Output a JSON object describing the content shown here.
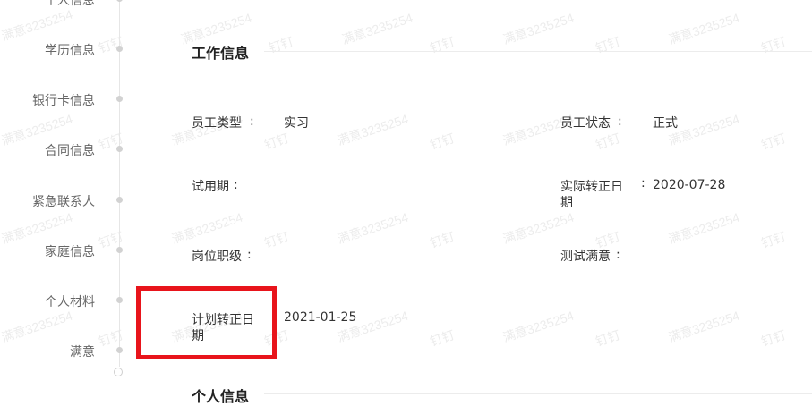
{
  "nav": {
    "items": [
      {
        "label": "个人信息"
      },
      {
        "label": "学历信息"
      },
      {
        "label": "银行卡信息"
      },
      {
        "label": "合同信息"
      },
      {
        "label": "紧急联系人"
      },
      {
        "label": "家庭信息"
      },
      {
        "label": "个人材料"
      },
      {
        "label": "满意"
      }
    ]
  },
  "work_section": {
    "title": "工作信息",
    "fields": [
      {
        "label": "员工类型",
        "value": "实习"
      },
      {
        "label": "员工状态",
        "value": "正式"
      },
      {
        "label": "试用期",
        "value": ""
      },
      {
        "label": "实际转正日期",
        "value": "2020-07-28"
      },
      {
        "label": "岗位职级",
        "value": ""
      },
      {
        "label": "测试满意",
        "value": ""
      },
      {
        "label": "计划转正日期",
        "value": "2021-01-25"
      }
    ],
    "separator": ":"
  },
  "personal_section": {
    "title": "个人信息"
  },
  "watermark": {
    "text_id": "满意3235254",
    "text_app": "钉钉"
  },
  "colors": {
    "highlight": "#e8141b",
    "nav_text": "#666666",
    "text": "#333333"
  }
}
